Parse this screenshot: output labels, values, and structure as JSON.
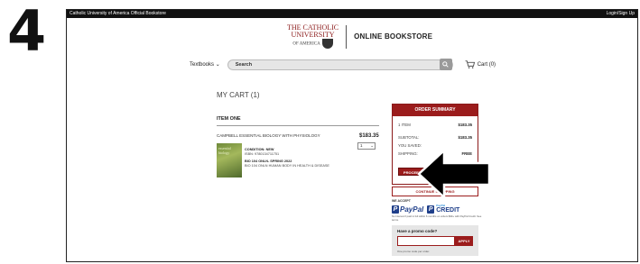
{
  "step_number": "4",
  "topbar": {
    "left": "Catholic University of America Official Bookstore",
    "right": "Login/Sign Up"
  },
  "brand": {
    "crest_line1": "THE CATHOLIC",
    "crest_line2": "UNIVERSITY",
    "crest_line3": "OF AMERICA",
    "name": "ONLINE BOOKSTORE"
  },
  "nav": {
    "textbooks": "Textbooks",
    "search_placeholder": "Search",
    "cart": "Cart (0)"
  },
  "cart": {
    "title": "MY CART (1)",
    "item_heading": "ITEM ONE",
    "item": {
      "title": "CAMPBELL ESSENTIAL BIOLOGY WITH PHYSIOLOGY",
      "price": "$183.35",
      "qty": "1",
      "cover_text": "essential biology",
      "condition_label": "CONDITION: NEW",
      "isbn": "ISBN: 9780134711751",
      "term": "BIO 104 ONLN- SPRING 2022",
      "course": "BIO 104 ONLN HUMAN BODY IN HEALTH & DISEASE"
    }
  },
  "summary": {
    "heading": "ORDER SUMMARY",
    "rows": [
      {
        "label": "1 ITEM",
        "value": "$183.35"
      },
      {
        "label": "SUBTOTAL:",
        "value": "$183.35"
      },
      {
        "label": "YOU SAVED:",
        "value": ""
      },
      {
        "label": "SHIPPING:",
        "value": "FREE"
      }
    ],
    "checkout_label": "PROCEED TO CHECKOUT",
    "continue_label": "CONTINUE SHOPPING"
  },
  "payment": {
    "we_accept": "WE ACCEPT",
    "paypal": "PayPal",
    "credit_small": "PayPal",
    "credit": "CREDIT",
    "fine_print": "No Interest if paid in full within 6 months on orders $99+ with PayPal Credit. See terms."
  },
  "promo": {
    "label": "Have a promo code?",
    "apply": "APPLY",
    "note": "One promo code per order."
  },
  "colors": {
    "brand_red": "#9b1c1c",
    "paypal_blue": "#1f3f8a"
  }
}
